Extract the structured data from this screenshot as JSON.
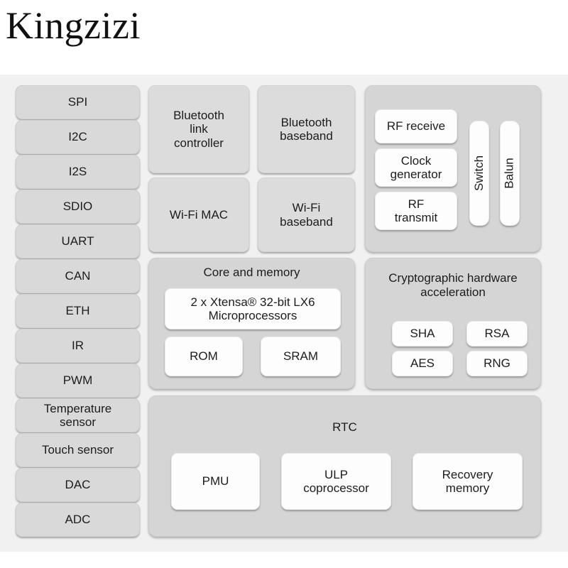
{
  "brand": {
    "title": "Kingzizi"
  },
  "colors": {
    "page_background": "#ffffff",
    "diagram_background": "#f1f1f1",
    "peripheral_block": "#d9d9d9",
    "radio_block": "#dcdcdc",
    "panel_background": "#d5d5d5",
    "inner_block": "#fdfdfd",
    "text": "#1c1c1c"
  },
  "diagram": {
    "peripherals": [
      {
        "label": "SPI"
      },
      {
        "label": "I2C"
      },
      {
        "label": "I2S"
      },
      {
        "label": "SDIO"
      },
      {
        "label": "UART"
      },
      {
        "label": "CAN"
      },
      {
        "label": "ETH"
      },
      {
        "label": "IR"
      },
      {
        "label": "PWM"
      },
      {
        "label": "Temperature\nsensor"
      },
      {
        "label": "Touch sensor"
      },
      {
        "label": "DAC"
      },
      {
        "label": "ADC"
      }
    ],
    "radio": [
      {
        "label": "Bluetooth\nlink\ncontroller"
      },
      {
        "label": "Bluetooth\nbaseband"
      },
      {
        "label": "Wi-Fi MAC"
      },
      {
        "label": "Wi-Fi\nbaseband"
      }
    ],
    "rf": {
      "blocks": [
        {
          "label": "RF receive"
        },
        {
          "label": "Clock\ngenerator"
        },
        {
          "label": "RF\ntransmit"
        }
      ],
      "pills": [
        {
          "label": "Switch"
        },
        {
          "label": "Balun"
        }
      ]
    },
    "core": {
      "title": "Core and memory",
      "cpu": "2 x Xtensa® 32-bit LX6\nMicroprocessors",
      "memories": [
        {
          "label": "ROM"
        },
        {
          "label": "SRAM"
        }
      ]
    },
    "crypto": {
      "title": "Cryptographic hardware\nacceleration",
      "blocks": [
        {
          "label": "SHA"
        },
        {
          "label": "RSA"
        },
        {
          "label": "AES"
        },
        {
          "label": "RNG"
        }
      ]
    },
    "rtc": {
      "title": "RTC",
      "blocks": [
        {
          "label": "PMU"
        },
        {
          "label": "ULP\ncoprocessor"
        },
        {
          "label": "Recovery\nmemory"
        }
      ]
    }
  }
}
